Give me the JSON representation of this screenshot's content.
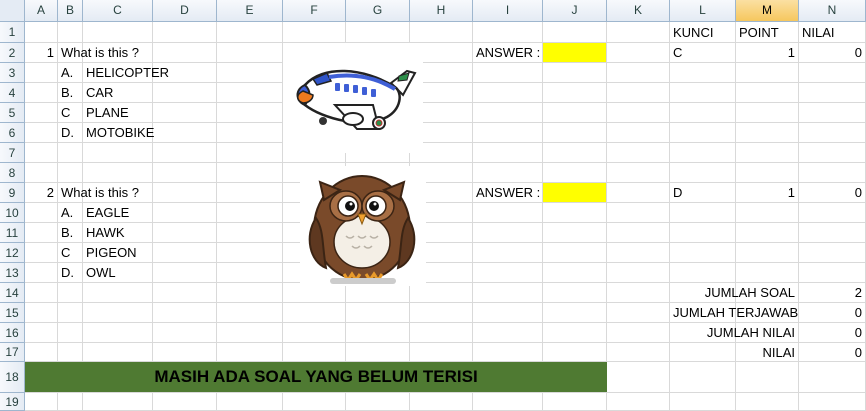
{
  "columns": [
    "A",
    "B",
    "C",
    "D",
    "E",
    "F",
    "G",
    "H",
    "I",
    "J",
    "K",
    "L",
    "M",
    "N"
  ],
  "selected_column": "M",
  "rows": [
    "1",
    "2",
    "3",
    "4",
    "5",
    "6",
    "7",
    "8",
    "9",
    "10",
    "11",
    "12",
    "13",
    "14",
    "15",
    "16",
    "17",
    "18",
    "19"
  ],
  "headers": {
    "kunci": "KUNCI",
    "point": "POINT",
    "nilai": "NILAI"
  },
  "questions": [
    {
      "number": "1",
      "text": "What is this ?",
      "answer_label": "ANSWER :",
      "answer_value": "",
      "options": [
        {
          "letter": "A.",
          "text": "HELICOPTER"
        },
        {
          "letter": "B.",
          "text": "CAR"
        },
        {
          "letter": "C",
          "text": "PLANE"
        },
        {
          "letter": "D.",
          "text": "MOTOBIKE"
        }
      ],
      "kunci": "C",
      "point": "1",
      "nilai": "0",
      "image": "airplane-image"
    },
    {
      "number": "2",
      "text": "What is this ?",
      "answer_label": "ANSWER :",
      "answer_value": "",
      "options": [
        {
          "letter": "A.",
          "text": "EAGLE"
        },
        {
          "letter": "B.",
          "text": "HAWK"
        },
        {
          "letter": "C",
          "text": "PIGEON"
        },
        {
          "letter": "D.",
          "text": "OWL"
        }
      ],
      "kunci": "D",
      "point": "1",
      "nilai": "0",
      "image": "owl-image"
    }
  ],
  "summary": [
    {
      "label": "JUMLAH SOAL",
      "value": "2"
    },
    {
      "label": "JUMLAH TERJAWAB",
      "value": "0"
    },
    {
      "label": "JUMLAH NILAI",
      "value": "0"
    },
    {
      "label": "NILAI",
      "value": "0"
    }
  ],
  "banner": "MASIH ADA SOAL YANG BELUM TERISI",
  "colors": {
    "answer_fill": "#ffff00",
    "banner_fill": "#4f7a32",
    "selected_header": "#f6c75e"
  }
}
